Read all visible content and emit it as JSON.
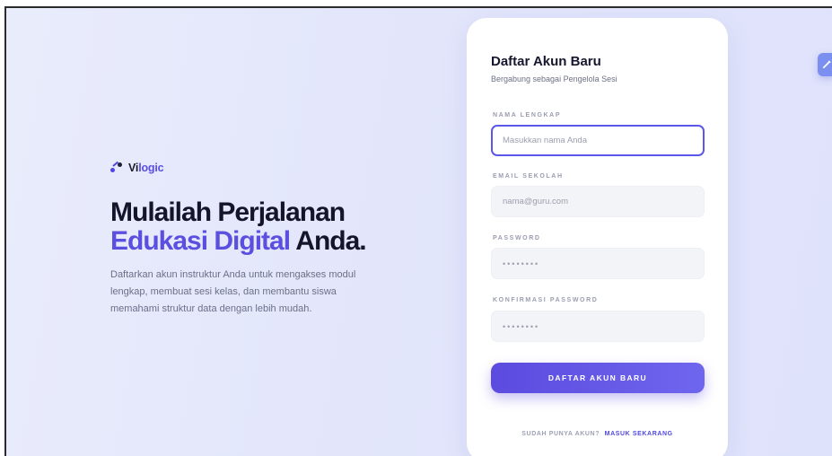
{
  "brand": {
    "name_prefix": "Vi",
    "name_accent": "logic"
  },
  "hero": {
    "title_line1": "Mulailah Perjalanan",
    "title_accent": "Edukasi Digital",
    "title_end": "Anda",
    "title_dot": ".",
    "description": "Daftarkan akun instruktur Anda untuk mengakses modul lengkap, membuat sesi kelas, dan membantu siswa memahami struktur data dengan lebih mudah."
  },
  "form": {
    "title": "Daftar Akun Baru",
    "subtitle": "Bergabung sebagai Pengelola Sesi",
    "fields": [
      {
        "label": "NAMA LENGKAP",
        "value": "",
        "placeholder": "Masukkan nama Anda"
      },
      {
        "label": "EMAIL SEKOLAH",
        "value": "",
        "placeholder": "nama@guru.com"
      },
      {
        "label": "PASSWORD",
        "value": "",
        "placeholder": "••••••••"
      },
      {
        "label": "KONFIRMASI PASSWORD",
        "value": "",
        "placeholder": "••••••••"
      }
    ],
    "submit_label": "DAFTAR AKUN BARU",
    "footer_question": "SUDAH PUNYA AKUN?",
    "footer_link": "MASUK SEKARANG"
  },
  "colors": {
    "accent": "#5b4fe0",
    "background": "#e5e8fb",
    "card": "#ffffff",
    "focus_border": "#5b57e8"
  },
  "icons": {
    "brand": "vilogic-logo-icon",
    "edit": "pencil-edit-icon"
  }
}
